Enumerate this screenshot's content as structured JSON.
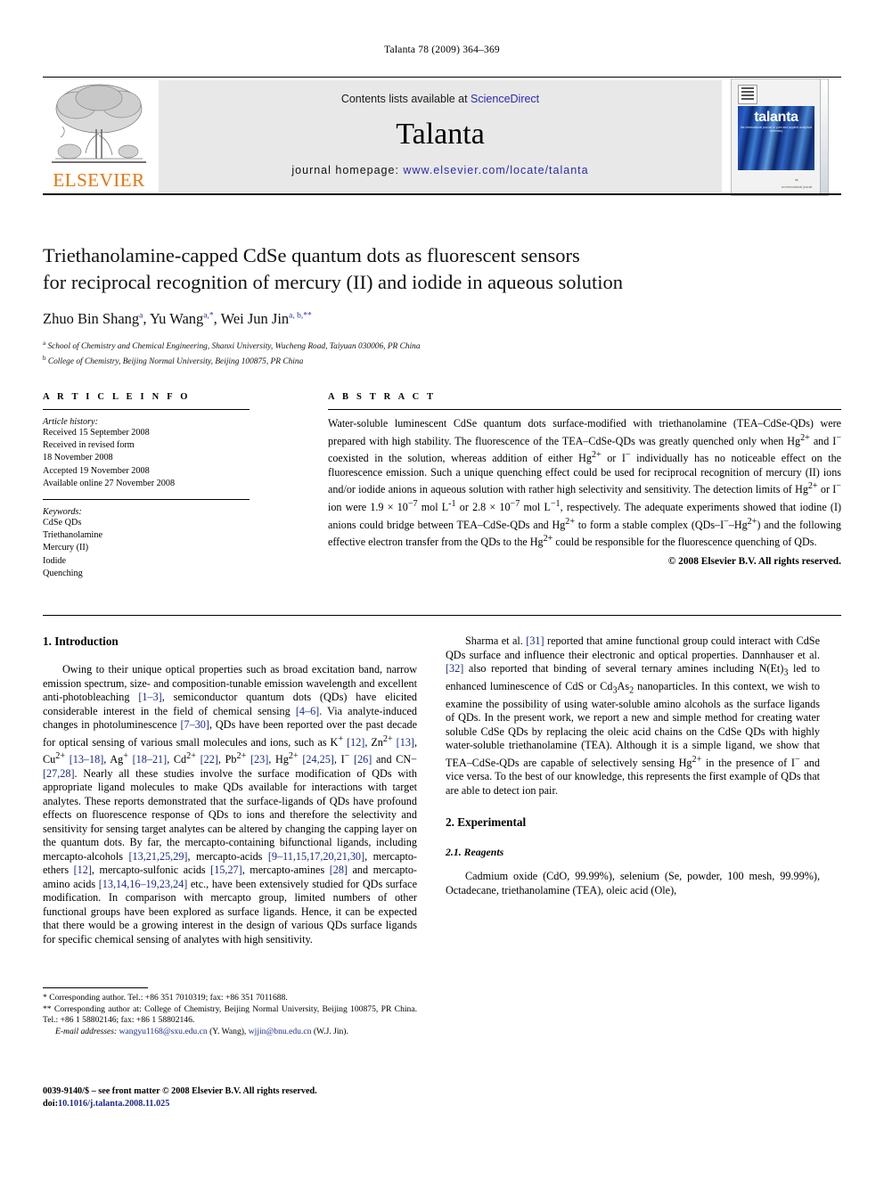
{
  "running_head": "Talanta 78 (2009) 364–369",
  "masthead": {
    "publisher_name": "ELSEVIER",
    "contents_prefix": "Contents lists available at ",
    "contents_link": "ScienceDirect",
    "journal_name": "Talanta",
    "homepage_prefix": "journal homepage: ",
    "homepage_url": "www.elsevier.com/locate/talanta",
    "cover": {
      "title": "talanta",
      "subtitle": "the international journal of pure and applied analytical chemistry",
      "footer": "an international journal"
    }
  },
  "article": {
    "title_line1": "Triethanolamine-capped CdSe quantum dots as fluorescent sensors",
    "title_line2": "for reciprocal recognition of mercury (II) and iodide in aqueous solution",
    "authors": [
      {
        "name": "Zhuo Bin Shang",
        "marks": "a"
      },
      {
        "name": "Yu Wang",
        "marks": "a,*"
      },
      {
        "name": "Wei Jun Jin",
        "marks": "a, b,**"
      }
    ],
    "affiliations": [
      {
        "mark": "a",
        "text": "School of Chemistry and Chemical Engineering, Shanxi University, Wucheng Road, Taiyuan 030006, PR China"
      },
      {
        "mark": "b",
        "text": "College of Chemistry, Beijing Normal University, Beijing 100875, PR China"
      }
    ]
  },
  "article_info": {
    "heading": "A R T I C L E  I N F O",
    "history_label": "Article history:",
    "history": [
      "Received 15 September 2008",
      "Received in revised form",
      "18 November 2008",
      "Accepted 19 November 2008",
      "Available online 27 November 2008"
    ],
    "keywords_label": "Keywords:",
    "keywords": [
      "CdSe QDs",
      "Triethanolamine",
      "Mercury (II)",
      "Iodide",
      "Quenching"
    ]
  },
  "abstract": {
    "heading": "A B S T R A C T",
    "text": "Water-soluble luminescent CdSe quantum dots surface-modified with triethanolamine (TEA–CdSe-QDs) were prepared with high stability. The fluorescence of the TEA–CdSe-QDs was greatly quenched only when Hg2+ and I− coexisted in the solution, whereas addition of either Hg2+ or I− individually has no noticeable effect on the fluorescence emission. Such a unique quenching effect could be used for reciprocal recognition of mercury (II) ions and/or iodide anions in aqueous solution with rather high selectivity and sensitivity. The detection limits of Hg2+ or I− ion were 1.9 × 10−7 mol L-1 or 2.8 × 10−7 mol L−1, respectively. The adequate experiments showed that iodine (I) anions could bridge between TEA–CdSe-QDs and Hg2+ to form a stable complex (QDs–I−–Hg2+) and the following effective electron transfer from the QDs to the Hg2+ could be responsible for the fluorescence quenching of QDs.",
    "copyright": "© 2008 Elsevier B.V. All rights reserved."
  },
  "sections": {
    "introduction_heading": "1.  Introduction",
    "intro_p1": "Owing to their unique optical properties such as broad excitation band, narrow emission spectrum, size- and composition-tunable emission wavelength and excellent anti-photobleaching [1–3], semiconductor quantum dots (QDs) have elicited considerable interest in the field of chemical sensing [4–6]. Via analyte-induced changes in photoluminescence [7–30], QDs have been reported over the past decade for optical sensing of various small molecules and ions, such as K+ [12], Zn2+ [13], Cu2+ [13–18], Ag+ [18–21], Cd2+ [22], Pb2+ [23], Hg2+ [24,25], I− [26] and CN− [27,28]. Nearly all these studies involve the surface modification of QDs with appropriate ligand molecules to make QDs available for interactions with target analytes. These reports demonstrated that the surface-ligands of QDs have profound effects on fluorescence response of QDs to ions and therefore the selectivity and sensitivity for sensing target analytes can be altered by changing the capping layer on the quantum dots. By far, the mercapto-containing bifunctional ligands, including mercapto-alcohols [13,21,25,29], mercapto-acids [9–11,15,17,20,21,30], mercapto-ethers [12], mercapto-sulfonic acids [15,27], mercapto-amines [28] and mercapto-amino acids [13,14,16–19,23,24] etc., have been extensively studied for QDs surface modification. In comparison with mercapto group, limited numbers of other functional groups have been explored as surface ligands. Hence, it can be expected that there would be a growing interest in the design of various QDs surface ligands for specific chemical sensing of analytes with high sensitivity.",
    "intro_p2": "Sharma et al. [31] reported that amine functional group could interact with CdSe QDs surface and influence their electronic and optical properties. Dannhauser et al. [32] also reported that binding of several ternary amines including N(Et)3 led to enhanced luminescence of CdS or Cd3As2 nanoparticles. In this context, we wish to examine the possibility of using water-soluble amino alcohols as the surface ligands of QDs. In the present work, we report a new and simple method for creating water soluble CdSe QDs by replacing the oleic acid chains on the CdSe QDs with highly water-soluble triethanolamine (TEA). Although it is a simple ligand, we show that TEA–CdSe-QDs are capable of selectively sensing Hg2+ in the presence of I− and vice versa. To the best of our knowledge, this represents the first example of QDs that are able to detect ion pair.",
    "experimental_heading": "2.  Experimental",
    "reagents_heading": "2.1.  Reagents",
    "reagents_p1": "Cadmium oxide (CdO, 99.99%), selenium (Se, powder, 100 mesh, 99.99%), Octadecane, triethanolamine (TEA), oleic acid (Ole),"
  },
  "footnotes": {
    "note1": "*   Corresponding author. Tel.: +86 351 7010319; fax: +86 351 7011688.",
    "note2": "**   Corresponding author at: College of Chemistry, Beijing Normal University, Beijing 100875, PR China. Tel.: +86 1 58802146; fax: +86 1 58802146.",
    "email_label": "E-mail addresses:",
    "email1": "wangyu1168@sxu.edu.cn",
    "email1_person": "(Y. Wang),",
    "email2": "wjjin@bnu.edu.cn",
    "email2_person": "(W.J. Jin).",
    "imprint": "0039-9140/$ – see front matter © 2008 Elsevier B.V. All rights reserved.",
    "doi_label": "doi:",
    "doi": "10.1016/j.talanta.2008.11.025"
  }
}
